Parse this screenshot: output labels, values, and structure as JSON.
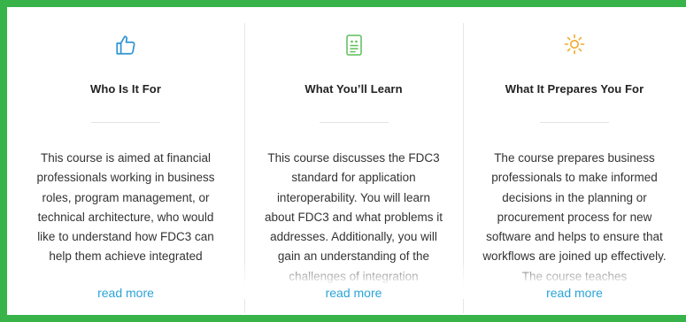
{
  "columns": [
    {
      "icon": "thumbs-up-icon",
      "icon_color": "#2f95d3",
      "heading": "Who Is It For",
      "body": "This course is aimed at financial professionals working in business roles, program management, or technical architecture, who would like to understand how FDC3 can help them achieve integrated",
      "read_more": "read more"
    },
    {
      "icon": "document-icon",
      "icon_color": "#5cbf5a",
      "heading": "What You’ll Learn",
      "body": "This course discusses the FDC3 standard for application interoperability. You will learn about FDC3 and what problems it addresses. Additionally, you will gain an understanding of the challenges of integration",
      "read_more": "read more"
    },
    {
      "icon": "sun-icon",
      "icon_color": "#f2a92b",
      "heading": "What It Prepares You For",
      "body": "The course prepares business professionals to make informed decisions in the planning or procurement process for new software and helps to ensure that workflows are joined up effectively. The course teaches",
      "read_more": "read more"
    }
  ],
  "colors": {
    "frame_border": "#37b34a",
    "link": "#2aa4d8",
    "background_outside": "#0e3a66"
  }
}
